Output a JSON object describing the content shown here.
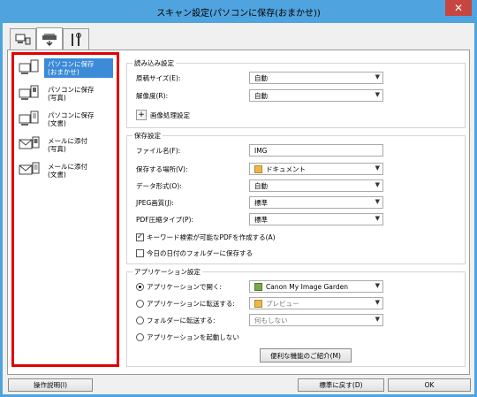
{
  "window": {
    "title": "スキャン設定(パソコンに保存(おまかせ))",
    "close_glyph": "✕"
  },
  "tabs": [
    {
      "icon": "scanner-to-pc-icon"
    },
    {
      "icon": "scanner-panel-icon"
    },
    {
      "icon": "tools-icon"
    }
  ],
  "sidebar": {
    "items": [
      {
        "label": "パソコンに保存\n(おまかせ)",
        "icon": "save-to-pc-auto-icon",
        "selected": true
      },
      {
        "label": "パソコンに保存\n(写真)",
        "icon": "save-to-pc-photo-icon",
        "selected": false
      },
      {
        "label": "パソコンに保存\n(文書)",
        "icon": "save-to-pc-document-icon",
        "selected": false
      },
      {
        "label": "メールに添付\n(写真)",
        "icon": "attach-mail-photo-icon",
        "selected": false
      },
      {
        "label": "メールに添付\n(文書)",
        "icon": "attach-mail-document-icon",
        "selected": false
      }
    ]
  },
  "scan_options": {
    "title": "読み込み設定",
    "paper_size_label": "原稿サイズ(E):",
    "paper_size_value": "自動",
    "resolution_label": "解像度(R):",
    "resolution_value": "自動",
    "image_processing_label": "画像処理設定",
    "plus_glyph": "+"
  },
  "save_settings": {
    "title": "保存設定",
    "file_name_label": "ファイル名(F):",
    "file_name_value": "IMG",
    "save_in_label": "保存する場所(V):",
    "save_in_value": "ドキュメント",
    "data_format_label": "データ形式(O):",
    "data_format_value": "自動",
    "jpeg_quality_label": "JPEG画質(J):",
    "jpeg_quality_value": "標準",
    "pdf_compression_label": "PDF圧縮タイプ(P):",
    "pdf_compression_value": "標準",
    "keyword_pdf_label": "キーワード検索が可能なPDFを作成する(A)",
    "keyword_pdf_checked": true,
    "subfolder_label": "今日の日付のフォルダーに保存する",
    "subfolder_checked": false
  },
  "app_settings": {
    "title": "アプリケーション設定",
    "open_with_label": "アプリケーションで開く:",
    "open_with_value": "Canon My Image Garden",
    "send_to_app_label": "アプリケーションに転送する:",
    "send_to_app_value": "プレビュー",
    "send_to_folder_label": "フォルダーに転送する:",
    "send_to_folder_value": "何もしない",
    "no_app_label": "アプリケーションを起動しない",
    "more_functions_label": "便利な機能のご紹介(M)",
    "selected_option": "open_with"
  },
  "footer": {
    "instructions_label": "操作説明(I)",
    "defaults_label": "標準に戻す(D)",
    "ok_label": "OK"
  },
  "colors": {
    "accent": "#3c8bd8",
    "highlight_border": "#e00000",
    "title_bar": "#4fa3de",
    "close": "#c7463f"
  }
}
